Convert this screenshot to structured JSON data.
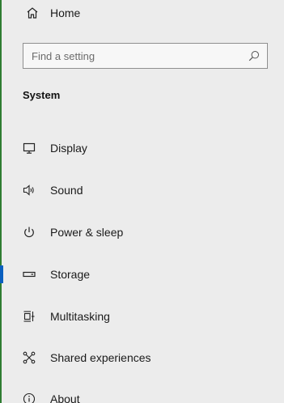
{
  "home": {
    "label": "Home",
    "icon": "home-icon"
  },
  "search": {
    "placeholder": "Find a setting",
    "icon": "search-icon"
  },
  "section": {
    "title": "System"
  },
  "nav": {
    "items": [
      {
        "label": "Display",
        "icon": "monitor-icon",
        "selected": false
      },
      {
        "label": "Sound",
        "icon": "speaker-icon",
        "selected": false
      },
      {
        "label": "Power & sleep",
        "icon": "power-icon",
        "selected": false
      },
      {
        "label": "Storage",
        "icon": "storage-icon",
        "selected": true
      },
      {
        "label": "Multitasking",
        "icon": "multitasking-icon",
        "selected": false
      },
      {
        "label": "Shared experiences",
        "icon": "shared-experiences-icon",
        "selected": false
      },
      {
        "label": "About",
        "icon": "info-icon",
        "selected": false
      }
    ]
  },
  "colors": {
    "background": "#ececec",
    "accent": "#0a5fbf"
  }
}
